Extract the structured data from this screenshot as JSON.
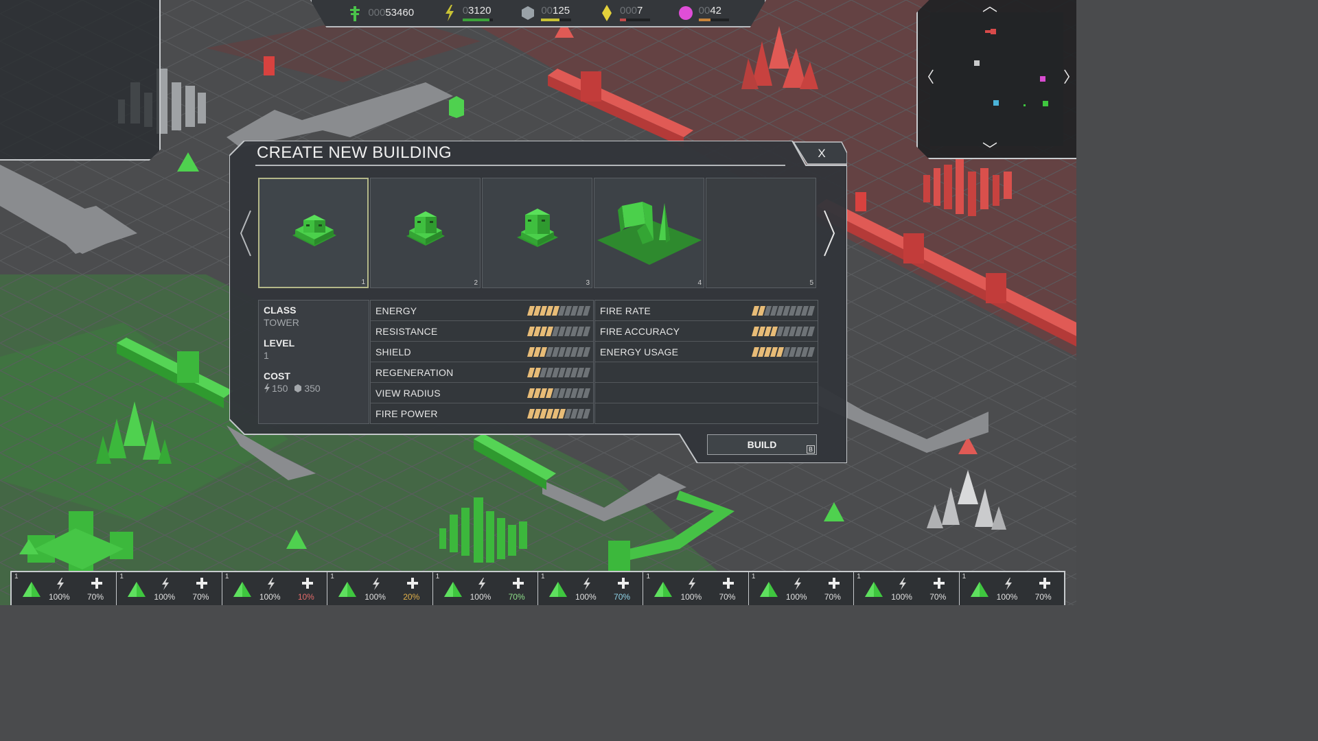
{
  "resources": [
    {
      "name": "credits",
      "pad": "000",
      "value": "53460",
      "bar": 0,
      "bar_color": "#3da33a",
      "icon": "credits-icon",
      "color": "#4ac24a"
    },
    {
      "name": "energy",
      "pad": "0",
      "value": "3120",
      "bar": 0.9,
      "bar_color": "#3da33a",
      "icon": "energy-icon",
      "color": "#c8c235"
    },
    {
      "name": "metal",
      "pad": "00",
      "value": "125",
      "bar": 0.6,
      "bar_color": "#c8c235",
      "icon": "metal-icon",
      "color": "#9aa2a8"
    },
    {
      "name": "crystal",
      "pad": "000",
      "value": "7",
      "bar": 0.2,
      "bar_color": "#c34a4a",
      "icon": "crystal-icon",
      "color": "#e3d13b"
    },
    {
      "name": "orb",
      "pad": "00",
      "value": "42",
      "bar": 0.4,
      "bar_color": "#c8843a",
      "icon": "orb-icon",
      "color": "#e04ed8"
    }
  ],
  "dialog": {
    "title": "CREATE NEW BUILDING",
    "close_label": "X",
    "buildings": [
      {
        "slot": "1",
        "selected": true
      },
      {
        "slot": "2",
        "selected": false
      },
      {
        "slot": "3",
        "selected": false
      },
      {
        "slot": "4",
        "selected": false
      },
      {
        "slot": "5",
        "selected": false
      }
    ],
    "info": {
      "class_label": "CLASS",
      "class_value": "TOWER",
      "level_label": "LEVEL",
      "level_value": "1",
      "cost_label": "COST",
      "cost_energy": "150",
      "cost_metal": "350"
    },
    "stats_left": [
      {
        "name": "ENERGY",
        "level": 5
      },
      {
        "name": "RESISTANCE",
        "level": 4
      },
      {
        "name": "SHIELD",
        "level": 3
      },
      {
        "name": "REGENERATION",
        "level": 2
      },
      {
        "name": "VIEW RADIUS",
        "level": 4
      },
      {
        "name": "FIRE POWER",
        "level": 6
      }
    ],
    "stats_right": [
      {
        "name": "FIRE RATE",
        "level": 2
      },
      {
        "name": "FIRE ACCURACY",
        "level": 4
      },
      {
        "name": "ENERGY USAGE",
        "level": 5
      }
    ],
    "stat_max": 10,
    "build_label": "BUILD",
    "build_hotkey": "B"
  },
  "units": [
    {
      "idx": "1",
      "energy": "100%",
      "health": "70%",
      "health_color": "#e0e0e0"
    },
    {
      "idx": "1",
      "energy": "100%",
      "health": "70%",
      "health_color": "#e0e0e0"
    },
    {
      "idx": "1",
      "energy": "100%",
      "health": "10%",
      "health_color": "#e56b6b"
    },
    {
      "idx": "1",
      "energy": "100%",
      "health": "20%",
      "health_color": "#e0b04a"
    },
    {
      "idx": "1",
      "energy": "100%",
      "health": "70%",
      "health_color": "#8fe08a"
    },
    {
      "idx": "1",
      "energy": "100%",
      "health": "70%",
      "health_color": "#8fd4e8"
    },
    {
      "idx": "1",
      "energy": "100%",
      "health": "70%",
      "health_color": "#e0e0e0"
    },
    {
      "idx": "1",
      "energy": "100%",
      "health": "70%",
      "health_color": "#e0e0e0"
    },
    {
      "idx": "1",
      "energy": "100%",
      "health": "70%",
      "health_color": "#e0e0e0"
    },
    {
      "idx": "1",
      "energy": "100%",
      "health": "70%",
      "health_color": "#e0e0e0"
    }
  ],
  "colors": {
    "player": "#3fc63f",
    "enemy": "#d84a4a",
    "neutral": "#c9cacb",
    "accent_bar": "#e8bc77"
  }
}
